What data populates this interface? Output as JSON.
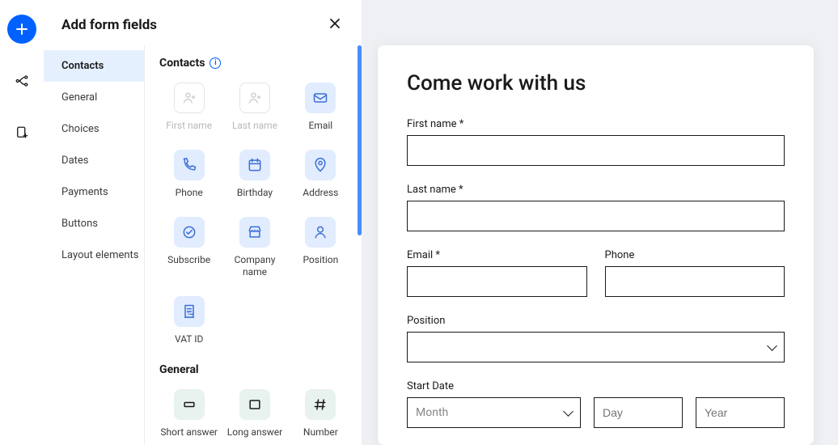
{
  "panel": {
    "title": "Add form fields",
    "categories": [
      "Contacts",
      "General",
      "Choices",
      "Dates",
      "Payments",
      "Buttons",
      "Layout elements"
    ],
    "active_category": "Contacts",
    "sections": [
      {
        "title": "Contacts",
        "info": true,
        "fields": [
          {
            "label": "First name",
            "icon": "person",
            "state": "disabled"
          },
          {
            "label": "Last name",
            "icon": "person",
            "state": "disabled"
          },
          {
            "label": "Email",
            "icon": "mail",
            "state": "active"
          },
          {
            "label": "Phone",
            "icon": "phone",
            "state": "active"
          },
          {
            "label": "Birthday",
            "icon": "calendar",
            "state": "active"
          },
          {
            "label": "Address",
            "icon": "pin",
            "state": "active"
          },
          {
            "label": "Subscribe",
            "icon": "check",
            "state": "active"
          },
          {
            "label": "Company name",
            "icon": "store",
            "state": "active"
          },
          {
            "label": "Position",
            "icon": "user",
            "state": "active"
          },
          {
            "label": "VAT ID",
            "icon": "receipt",
            "state": "active"
          }
        ]
      },
      {
        "title": "General",
        "info": false,
        "fields": [
          {
            "label": "Short answer",
            "icon": "short",
            "state": "neutral"
          },
          {
            "label": "Long answer",
            "icon": "long",
            "state": "neutral"
          },
          {
            "label": "Number",
            "icon": "hash",
            "state": "neutral"
          }
        ]
      }
    ]
  },
  "preview": {
    "title": "Come work with us",
    "fields": {
      "first_name": "First name *",
      "last_name": "Last name *",
      "email": "Email *",
      "phone": "Phone",
      "position": "Position",
      "start_date": "Start Date",
      "month_placeholder": "Month",
      "day_placeholder": "Day",
      "year_placeholder": "Year"
    }
  }
}
